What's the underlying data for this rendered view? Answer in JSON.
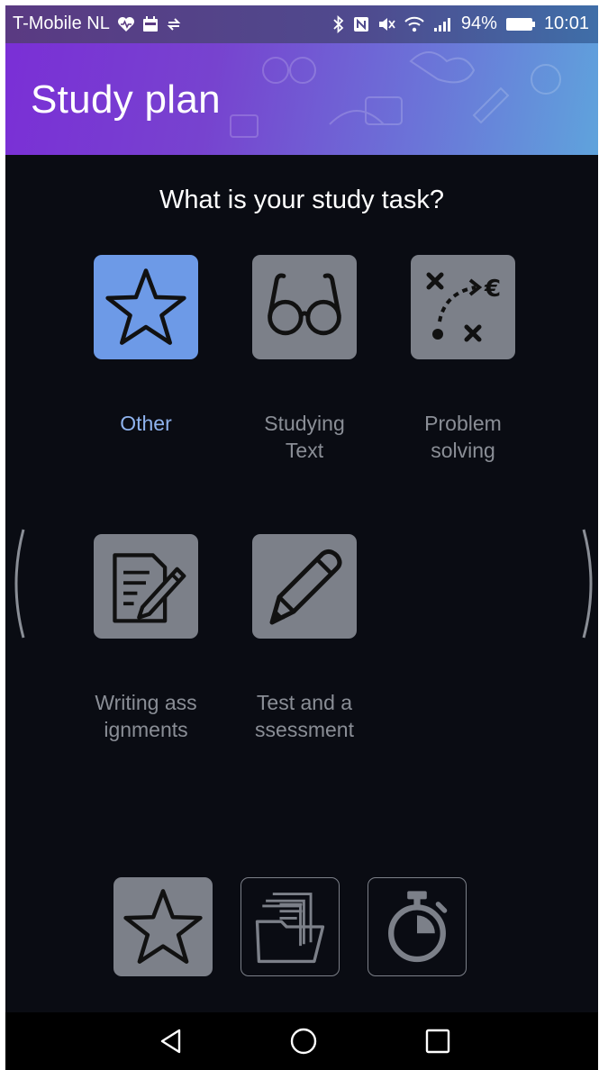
{
  "status_bar": {
    "carrier": "T-Mobile NL",
    "battery": "94%",
    "time": "10:01"
  },
  "header": {
    "title": "Study plan"
  },
  "main": {
    "question": "What is your study task?",
    "tasks": [
      {
        "label_line1": "Other",
        "label_line2": "",
        "icon": "star-icon",
        "selected": true
      },
      {
        "label_line1": "Studying",
        "label_line2": "Text",
        "icon": "glasses-icon",
        "selected": false
      },
      {
        "label_line1": "Problem",
        "label_line2": "solving",
        "icon": "strategy-icon",
        "selected": false
      },
      {
        "label_line1": "Writing ass",
        "label_line2": "ignments",
        "icon": "document-pen-icon",
        "selected": false
      },
      {
        "label_line1": "Test and a",
        "label_line2": "ssessment",
        "icon": "pencil-icon",
        "selected": false
      }
    ]
  },
  "bottom_toolbar": {
    "items": [
      "star-icon",
      "folder-icon",
      "stopwatch-icon"
    ]
  },
  "colors": {
    "background": "#0a0c13",
    "tile": "#7c8089",
    "tile_selected": "#6d9ae7",
    "label": "#8a8e96",
    "label_selected": "#8fb3ee"
  }
}
